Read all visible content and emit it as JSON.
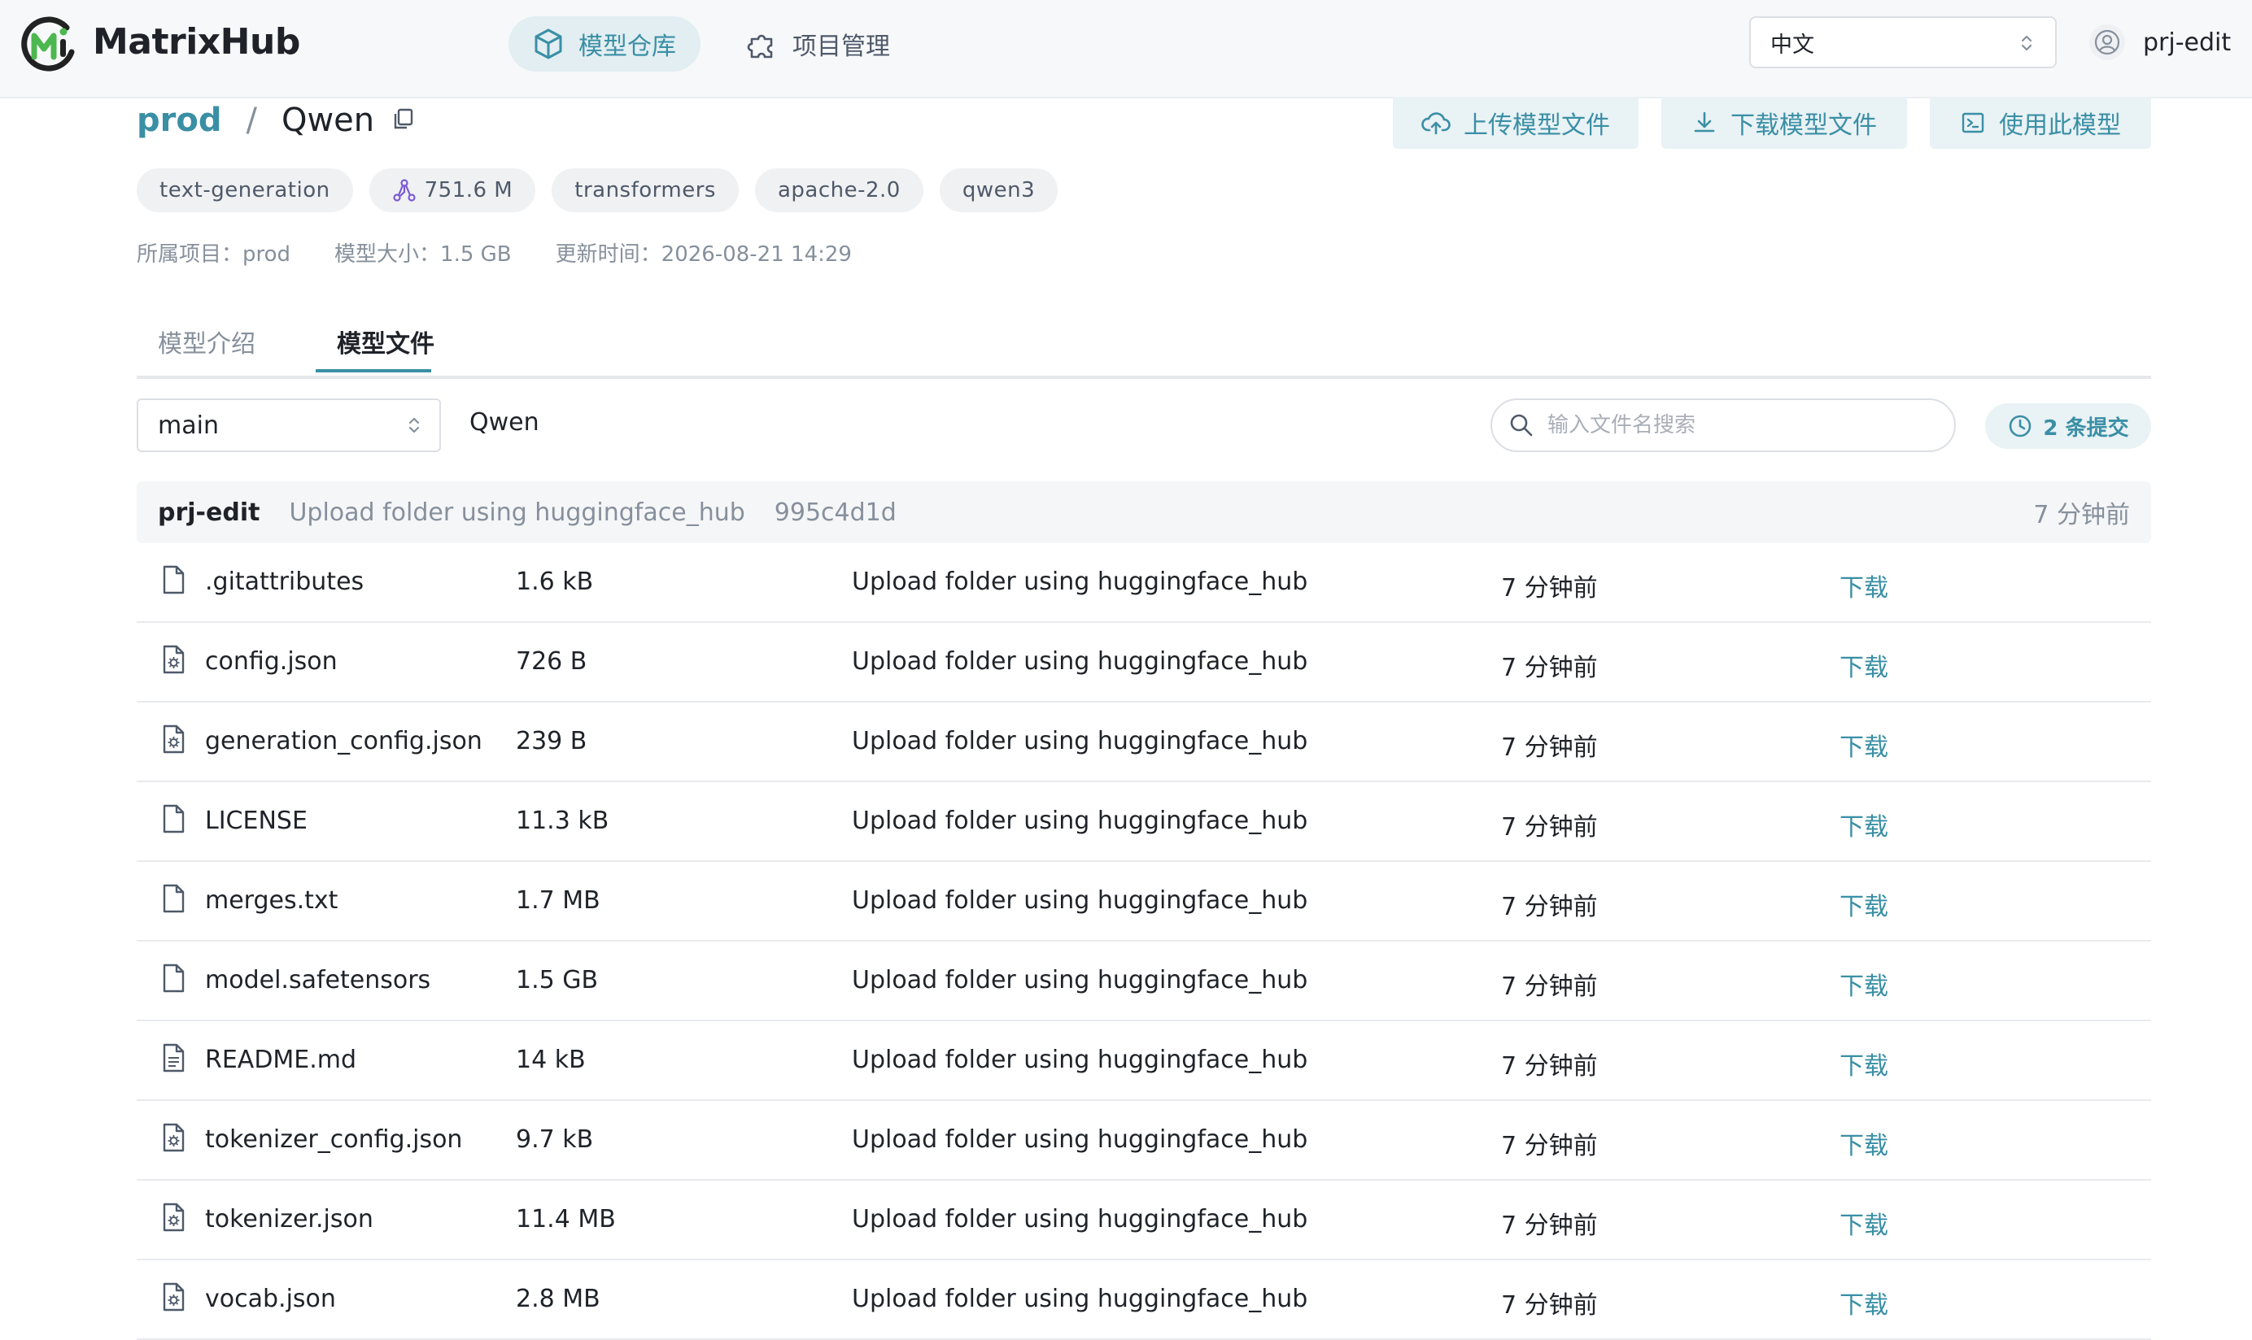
{
  "app": {
    "name": "MatrixHub",
    "colors": {
      "accent": "#3a8fa5",
      "accent_bg": "#e9f2f5",
      "logo_green": "#4cb84f",
      "logo_dark": "#222222"
    }
  },
  "nav": {
    "tabs": [
      {
        "label": "模型仓库",
        "icon": "cube-icon",
        "active": true
      },
      {
        "label": "项目管理",
        "icon": "puzzle-icon",
        "active": false
      }
    ],
    "language": "中文",
    "user": "prj-edit"
  },
  "model": {
    "project": "prod",
    "separator": "/",
    "name": "Qwen",
    "actions": [
      {
        "label": "上传模型文件",
        "icon": "cloud-upload-icon"
      },
      {
        "label": "下载模型文件",
        "icon": "download-icon"
      },
      {
        "label": "使用此模型",
        "icon": "terminal-icon"
      }
    ],
    "tags": [
      "text-generation",
      "751.6 M",
      "transformers",
      "apache-2.0",
      "qwen3"
    ],
    "meta": {
      "project": "所属项目：prod",
      "size": "模型大小：1.5 GB",
      "updated": "更新时间：2026-08-21 14:29"
    }
  },
  "tabs": [
    {
      "label": "模型介绍",
      "active": false
    },
    {
      "label": "模型文件",
      "active": true
    }
  ],
  "toolbar": {
    "branch": "main",
    "path": "Qwen",
    "search_placeholder": "输入文件名搜索",
    "commits_label": "2 条提交"
  },
  "latest_commit": {
    "author": "prj-edit",
    "message": "Upload folder using huggingface_hub",
    "hash": "995c4d1d",
    "time": "7 分钟前"
  },
  "files": [
    {
      "name": ".gitattributes",
      "size": "1.6 kB",
      "message": "Upload folder using huggingface_hub",
      "time": "7 分钟前",
      "action": "下载",
      "icon": "file-icon"
    },
    {
      "name": "config.json",
      "size": "726 B",
      "message": "Upload folder using huggingface_hub",
      "time": "7 分钟前",
      "action": "下载",
      "icon": "config-file-icon"
    },
    {
      "name": "generation_config.json",
      "size": "239 B",
      "message": "Upload folder using huggingface_hub",
      "time": "7 分钟前",
      "action": "下载",
      "icon": "config-file-icon"
    },
    {
      "name": "LICENSE",
      "size": "11.3 kB",
      "message": "Upload folder using huggingface_hub",
      "time": "7 分钟前",
      "action": "下载",
      "icon": "file-icon"
    },
    {
      "name": "merges.txt",
      "size": "1.7 MB",
      "message": "Upload folder using huggingface_hub",
      "time": "7 分钟前",
      "action": "下载",
      "icon": "file-icon"
    },
    {
      "name": "model.safetensors",
      "size": "1.5 GB",
      "message": "Upload folder using huggingface_hub",
      "time": "7 分钟前",
      "action": "下载",
      "icon": "file-icon"
    },
    {
      "name": "README.md",
      "size": "14 kB",
      "message": "Upload folder using huggingface_hub",
      "time": "7 分钟前",
      "action": "下载",
      "icon": "text-file-icon"
    },
    {
      "name": "tokenizer_config.json",
      "size": "9.7 kB",
      "message": "Upload folder using huggingface_hub",
      "time": "7 分钟前",
      "action": "下载",
      "icon": "config-file-icon"
    },
    {
      "name": "tokenizer.json",
      "size": "11.4 MB",
      "message": "Upload folder using huggingface_hub",
      "time": "7 分钟前",
      "action": "下载",
      "icon": "config-file-icon"
    },
    {
      "name": "vocab.json",
      "size": "2.8 MB",
      "message": "Upload folder using huggingface_hub",
      "time": "7 分钟前",
      "action": "下载",
      "icon": "config-file-icon"
    }
  ]
}
